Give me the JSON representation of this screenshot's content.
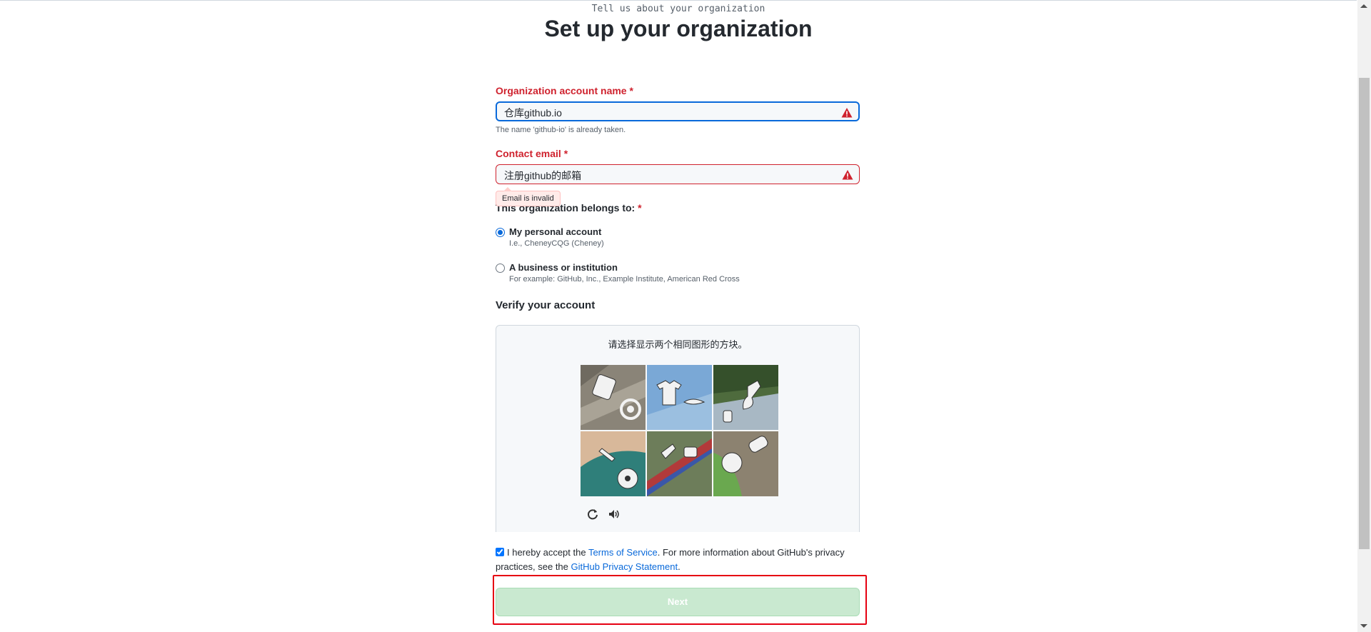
{
  "header": {
    "subtitle": "Tell us about your organization",
    "title": "Set up your organization"
  },
  "org_name": {
    "label": "Organization account name",
    "required_mark": "*",
    "value": "仓库github.io",
    "hint": "The name 'github-io' is already taken."
  },
  "contact_email": {
    "label": "Contact email",
    "required_mark": "*",
    "value": "注册github的邮箱",
    "error": "Email is invalid"
  },
  "belongs_to": {
    "label": "This organization belongs to:",
    "required_mark": "*",
    "options": [
      {
        "label": "My personal account",
        "note": "I.e., CheneyCQG (Cheney)",
        "selected": true
      },
      {
        "label": "A business or institution",
        "note": "For example: GitHub, Inc., Example Institute, American Red Cross",
        "selected": false
      }
    ]
  },
  "verify": {
    "title": "Verify your account",
    "prompt": "请选择显示两个相同图形的方块。",
    "tiles": [
      "tile-1",
      "tile-2",
      "tile-3",
      "tile-4",
      "tile-5",
      "tile-6"
    ],
    "controls": {
      "refresh_icon": "refresh-icon",
      "audio_icon": "speaker-icon"
    }
  },
  "terms": {
    "checked": true,
    "text_before": "I hereby accept the ",
    "tos_link": "Terms of Service",
    "text_middle": ". For more information about GitHub's privacy practices, see the ",
    "privacy_link": "GitHub Privacy Statement",
    "text_after": "."
  },
  "next_button": {
    "label": "Next",
    "disabled": true
  },
  "colors": {
    "error": "#cf222e",
    "link": "#0969da",
    "focus": "#0969da",
    "button_disabled": "#c9e9d0",
    "highlight": "#e60012"
  }
}
